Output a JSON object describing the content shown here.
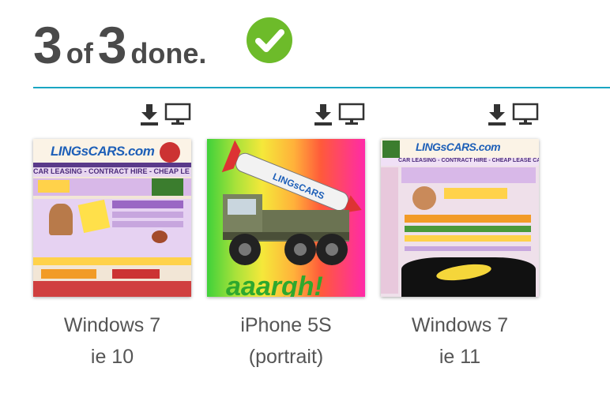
{
  "status": {
    "done_count": "3",
    "of_text": "of",
    "total_count": "3",
    "done_text": "done."
  },
  "colors": {
    "check_green": "#6dbb2a",
    "divider_teal": "#1aa6c2"
  },
  "screenshots": [
    {
      "os": "Windows 7",
      "browser": "ie 10",
      "thumb_text": "LINGsCARS.com",
      "thumb_subtitle": "CAR LEASING - CONTRACT HIRE - CHEAP LE"
    },
    {
      "os": "iPhone 5S",
      "browser": "(portrait)",
      "thumb_text": "aaargh!",
      "rocket_text": "LINGsCARS"
    },
    {
      "os": "Windows 7",
      "browser": "ie 11",
      "thumb_text": "LINGsCARS.com",
      "thumb_subtitle": "CAR LEASING - CONTRACT HIRE - CHEAP LEASE CARS"
    }
  ]
}
